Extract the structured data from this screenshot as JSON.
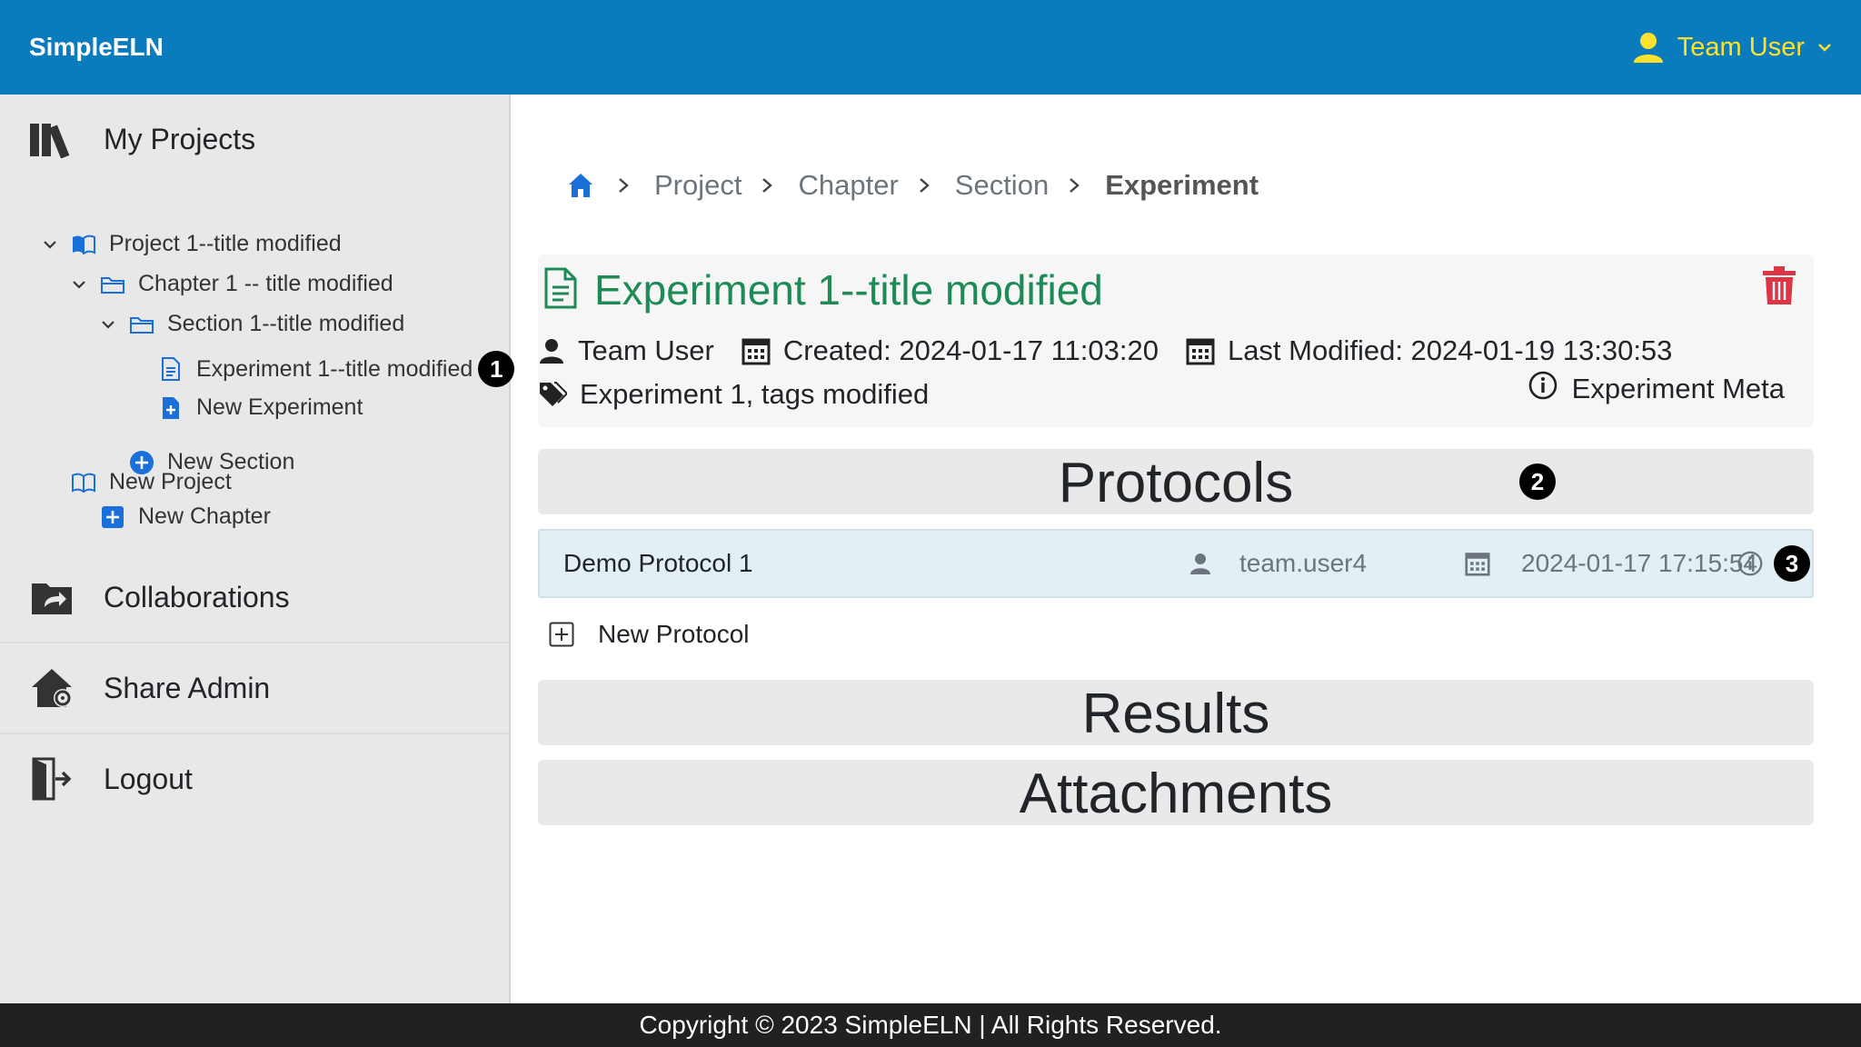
{
  "header": {
    "brand": "SimpleELN",
    "user_name": "Team User"
  },
  "sidebar": {
    "my_projects": "My Projects",
    "tree": {
      "project": "Project 1--title modified",
      "chapter": "Chapter 1 -- title modified",
      "section": "Section 1--title modified",
      "experiment": "Experiment 1--title modified",
      "new_experiment": "New Experiment",
      "new_section": "New Section",
      "new_chapter": "New Chapter",
      "new_project": "New Project"
    },
    "collaborations": "Collaborations",
    "share_admin": "Share Admin",
    "logout": "Logout"
  },
  "breadcrumb": [
    "Project",
    "Chapter",
    "Section",
    "Experiment"
  ],
  "experiment": {
    "title": "Experiment 1--title modified",
    "author": "Team User",
    "created": "Created: 2024-01-17 11:03:20",
    "last_modified": "Last Modified: 2024-01-19 13:30:53",
    "tags": "Experiment 1, tags modified",
    "meta_link": "Experiment Meta"
  },
  "sections": {
    "protocols": "Protocols",
    "results": "Results",
    "attachments": "Attachments"
  },
  "protocols": [
    {
      "name": "Demo Protocol 1",
      "user": "team.user4",
      "date": "2024-01-17 17:15:54"
    }
  ],
  "new_protocol": "New Protocol",
  "callouts": {
    "one": "1",
    "two": "2",
    "three": "3"
  },
  "footer": "Copyright © 2023 SimpleELN | All Rights Reserved.",
  "colors": {
    "header_bg": "#0a7bbd",
    "user_accent": "#fde12d",
    "title_green": "#1e8a55",
    "delete_red": "#dc3545",
    "link_blue": "#1a6fd8"
  }
}
